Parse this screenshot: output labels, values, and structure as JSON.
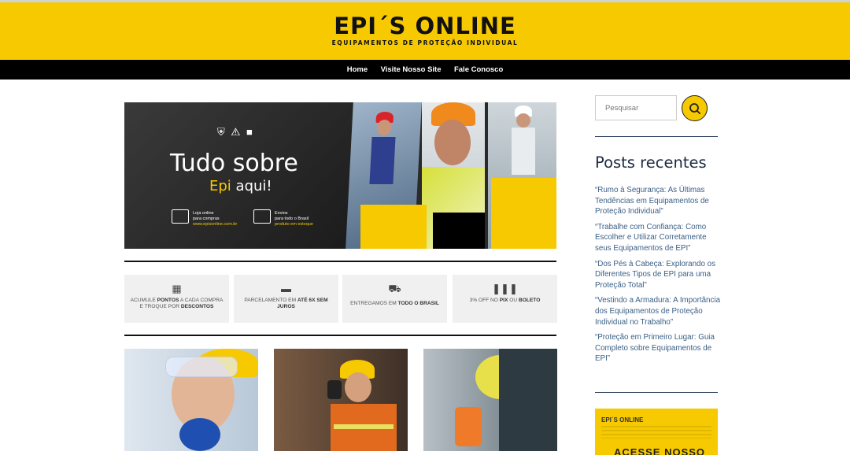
{
  "header": {
    "logo_title": "EPI´S ONLINE",
    "logo_subtitle": "EQUIPAMENTOS DE PROTEÇÃO INDIVIDUAL",
    "brand_color": "#f6c900"
  },
  "nav": {
    "items": [
      {
        "label": "Home"
      },
      {
        "label": "Visite Nosso Site"
      },
      {
        "label": "Fale Conosco"
      }
    ]
  },
  "hero": {
    "icons": [
      "shield-check-icon",
      "warning-icon",
      "user-icon"
    ],
    "title": "Tudo sobre",
    "subtitle_highlight": "Epi",
    "subtitle_rest": " aqui!",
    "features": [
      {
        "icon": "truck-icon",
        "line1": "Loja online",
        "line2": "para compras",
        "small": "www.episonline.com.br"
      },
      {
        "icon": "box-icon",
        "line1": "Envios",
        "line2": "para todo o Brasil",
        "small": "produto em estoque"
      }
    ]
  },
  "features": [
    {
      "icon": "basket-icon",
      "text_pre": "ACUMULE ",
      "text_b1": "PONTOS",
      "text_mid": " A CADA COMPRA E TROQUE POR ",
      "text_b2": "DESCONTOS"
    },
    {
      "icon": "credit-card-icon",
      "text_pre": "PARCELAMENTO EM ",
      "text_b1": "ATÉ 6X SEM JUROS",
      "text_mid": "",
      "text_b2": ""
    },
    {
      "icon": "truck-icon",
      "text_pre": "ENTREGAMOS EM ",
      "text_b1": "TODO O BRASIL",
      "text_mid": "",
      "text_b2": ""
    },
    {
      "icon": "barcode-icon",
      "text_pre": "3% OFF NO ",
      "text_b1": "PIX",
      "text_mid": " OU ",
      "text_b2": "BOLETO"
    }
  ],
  "sidebar": {
    "search_placeholder": "Pesquisar",
    "recent_title": "Posts recentes",
    "recent_posts": [
      "“Rumo à Segurança: As Últimas Tendências em Equipamentos de Proteção Individual”",
      "“Trabalhe com Confiança: Como Escolher e Utilizar Corretamente seus Equipamentos de EPI”",
      "“Dos Pés à Cabeça: Explorando os Diferentes Tipos de EPI para uma Proteção Total”",
      "“Vestindo a Armadura: A Importância dos Equipamentos de Proteção Individual no Trabalho”",
      "“Proteção em Primeiro Lugar: Guia Completo sobre Equipamentos de EPI”"
    ],
    "ad_brand": "EPI´S ONLINE",
    "ad_cta": "ACESSE NOSSO SITE"
  }
}
